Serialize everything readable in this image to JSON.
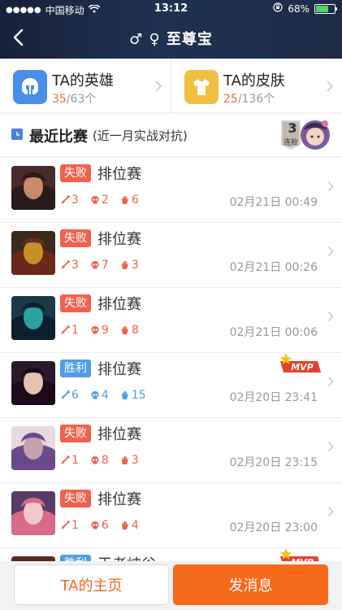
{
  "status_bar": {
    "signal_dots": "●●●●●",
    "carrier": "中国移动",
    "time": "13:12",
    "battery_percent": "68%",
    "battery_level": 0.68
  },
  "nav": {
    "title": "♂ ♀ 至尊宝"
  },
  "cards": [
    {
      "title": "TA的英雄",
      "count_highlight": "35",
      "count_rest": "/63个",
      "icon": "helmet-icon",
      "color": "#4a8fe7"
    },
    {
      "title": "TA的皮肤",
      "count_highlight": "25",
      "count_rest": "/136个",
      "icon": "shirt-icon",
      "color": "#f2c040"
    }
  ],
  "section": {
    "title": "最近比赛",
    "subtitle": "(近一月实战对抗)",
    "streak_number": "3",
    "streak_label": "连败"
  },
  "matches": [
    {
      "result": "失败",
      "outcome": "lose",
      "mode": "排位赛",
      "kills": "3",
      "deaths": "2",
      "assists": "6",
      "time": "02月21日 00:49",
      "mvp": false
    },
    {
      "result": "失败",
      "outcome": "lose",
      "mode": "排位赛",
      "kills": "3",
      "deaths": "7",
      "assists": "3",
      "time": "02月21日 00:26",
      "mvp": false
    },
    {
      "result": "失败",
      "outcome": "lose",
      "mode": "排位赛",
      "kills": "1",
      "deaths": "9",
      "assists": "8",
      "time": "02月21日 00:06",
      "mvp": false
    },
    {
      "result": "胜利",
      "outcome": "win",
      "mode": "排位赛",
      "kills": "6",
      "deaths": "4",
      "assists": "15",
      "time": "02月20日 23:41",
      "mvp": true
    },
    {
      "result": "失败",
      "outcome": "lose",
      "mode": "排位赛",
      "kills": "1",
      "deaths": "8",
      "assists": "3",
      "time": "02月20日 23:15",
      "mvp": false
    },
    {
      "result": "失败",
      "outcome": "lose",
      "mode": "排位赛",
      "kills": "1",
      "deaths": "6",
      "assists": "4",
      "time": "02月20日 23:00",
      "mvp": false
    },
    {
      "result": "胜利",
      "outcome": "win",
      "mode": "王者峡谷",
      "kills": "",
      "deaths": "",
      "assists": "",
      "time": "",
      "mvp": true
    }
  ],
  "mvp_label": "MVP",
  "bottom": {
    "home_label": "TA的主页",
    "message_label": "发消息"
  }
}
